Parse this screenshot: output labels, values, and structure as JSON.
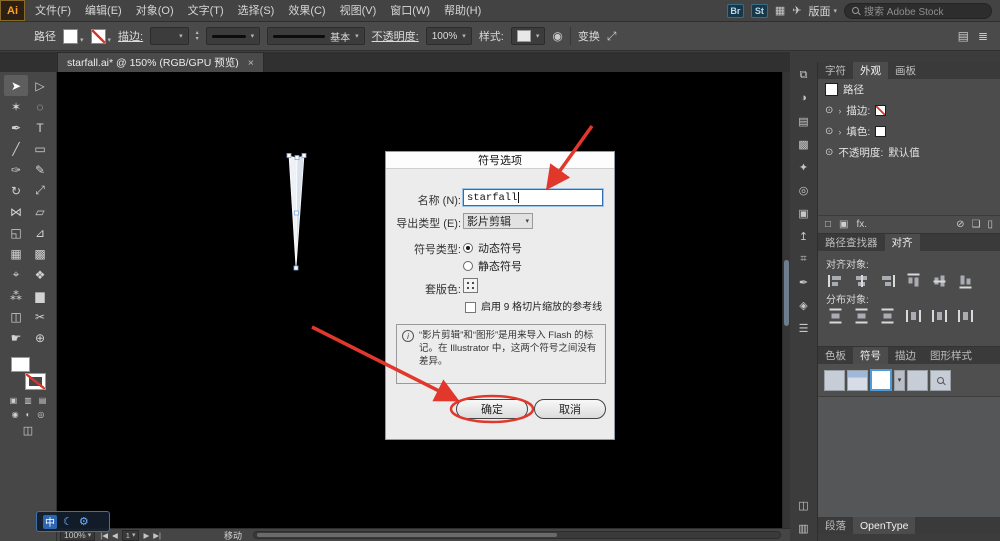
{
  "colors": {
    "annotation_red": "#e2372b",
    "selection_blue": "#4f9bd8",
    "canvas": "#000000"
  },
  "menubar": {
    "logo": "Ai",
    "items": [
      "文件(F)",
      "编辑(E)",
      "对象(O)",
      "文字(T)",
      "选择(S)",
      "效果(C)",
      "视图(V)",
      "窗口(W)",
      "帮助(H)"
    ],
    "br_label": "Br",
    "st_label": "St",
    "workspace_label": "版面",
    "search_placeholder": "搜索 Adobe Stock"
  },
  "controlbar": {
    "target_label": "路径",
    "stroke_label": "描边:",
    "brush_basic": "基本",
    "opacity_label": "不透明度:",
    "opacity_value": "100%",
    "style_label": "样式:",
    "transform_label": "变换"
  },
  "doc_tab": {
    "title": "starfall.ai* @ 150% (RGB/GPU 预览)",
    "close": "×"
  },
  "toolbar": {
    "tools": [
      {
        "name": "selection-tool",
        "glyph": "➤"
      },
      {
        "name": "direct-selection-tool",
        "glyph": "▷"
      },
      {
        "name": "magic-wand-tool",
        "glyph": "✶"
      },
      {
        "name": "lasso-tool",
        "glyph": "◌"
      },
      {
        "name": "pen-tool",
        "glyph": "✒"
      },
      {
        "name": "type-tool",
        "glyph": "T"
      },
      {
        "name": "line-segment-tool",
        "glyph": "╱"
      },
      {
        "name": "rectangle-tool",
        "glyph": "▭"
      },
      {
        "name": "paintbrush-tool",
        "glyph": "✑"
      },
      {
        "name": "pencil-tool",
        "glyph": "✎"
      },
      {
        "name": "rotate-tool",
        "glyph": "↻"
      },
      {
        "name": "scale-tool",
        "glyph": "⤢"
      },
      {
        "name": "width-tool",
        "glyph": "⋈"
      },
      {
        "name": "free-transform-tool",
        "glyph": "▱"
      },
      {
        "name": "shape-builder-tool",
        "glyph": "◱"
      },
      {
        "name": "perspective-grid-tool",
        "glyph": "⊿"
      },
      {
        "name": "mesh-tool",
        "glyph": "▦"
      },
      {
        "name": "gradient-tool",
        "glyph": "▩"
      },
      {
        "name": "eyedropper-tool",
        "glyph": "⌖"
      },
      {
        "name": "blend-tool",
        "glyph": "❖"
      },
      {
        "name": "symbol-sprayer-tool",
        "glyph": "⁂"
      },
      {
        "name": "column-graph-tool",
        "glyph": "▆"
      },
      {
        "name": "artboard-tool",
        "glyph": "◫"
      },
      {
        "name": "slice-tool",
        "glyph": "✂"
      },
      {
        "name": "hand-tool",
        "glyph": "☛"
      },
      {
        "name": "zoom-tool",
        "glyph": "⊕"
      }
    ]
  },
  "dialog": {
    "title": "符号选项",
    "name_label": "名称 (N):",
    "name_value": "starfall",
    "export_label": "导出类型 (E):",
    "export_value": "影片剪辑",
    "symbol_type_label": "符号类型:",
    "dynamic_label": "动态符号",
    "static_label": "静态符号",
    "registration_label": "套版色:",
    "nine_slice_label": "启用 9 格切片缩放的参考线",
    "info_text": "“影片剪辑”和“图形”是用来导入 Flash 的标记。在 Illustrator 中，这两个符号之间没有差异。",
    "ok_label": "确定",
    "cancel_label": "取消"
  },
  "panels": {
    "appearance": {
      "tabs": [
        "字符",
        "外观",
        "画板"
      ],
      "target": "路径",
      "stroke": "描边:",
      "fill": "填色:",
      "opacity_label": "不透明度:",
      "opacity_value": "默认值",
      "fx": "fx."
    },
    "align": {
      "tabs": [
        "路径查找器",
        "对齐"
      ],
      "align_objects": "对齐对象:",
      "distribute_objects": "分布对象:"
    },
    "symbols": {
      "tabs": [
        "色板",
        "符号",
        "描边",
        "图形样式"
      ]
    },
    "bottom_tabs": [
      "段落",
      "OpenType"
    ]
  },
  "statusbar": {
    "zoom": "100%",
    "frame": "1",
    "tool": "移动"
  },
  "ime": {
    "label": "中"
  },
  "icons": {
    "dropdown": "▾",
    "up": "▴",
    "grid": "▦",
    "share": "✈",
    "eye": "⊙",
    "chevron": "›",
    "menu": "≣",
    "moon": "☾",
    "gear": "⚙",
    "first": "|◀",
    "prev": "◀",
    "next": "▶",
    "last": "▶|",
    "info": "i",
    "recolor": "◉",
    "transform_ic": "⤢",
    "workspace_ic": "▤",
    "new_stroke": "□",
    "new_fill": "▣",
    "clear": "⊘",
    "duplicate": "❏",
    "trash": "▯",
    "dock": [
      "⧉",
      "◑",
      "▤",
      "▩",
      "✦",
      "◎",
      "▣",
      "↥",
      "⌗",
      "✒",
      "◈",
      "☰"
    ],
    "dock_bottom": [
      "◫",
      "▥"
    ]
  }
}
